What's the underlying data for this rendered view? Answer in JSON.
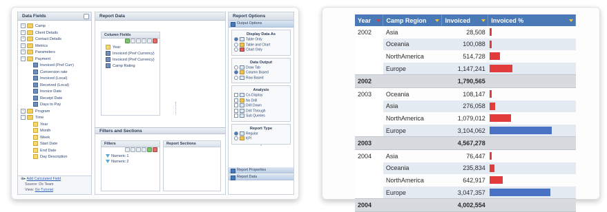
{
  "designer": {
    "data_fields_title": "Data Fields",
    "tree": [
      {
        "label": "Camp",
        "type": "folder",
        "level": 0,
        "expander": "+"
      },
      {
        "label": "Client Details",
        "type": "folder",
        "level": 0,
        "expander": "+"
      },
      {
        "label": "Contact Details",
        "type": "folder",
        "level": 0,
        "expander": "+"
      },
      {
        "label": "Metrics",
        "type": "folder",
        "level": 0,
        "expander": "+"
      },
      {
        "label": "Parameters",
        "type": "folder",
        "level": 0,
        "expander": "+"
      },
      {
        "label": "Payment",
        "type": "folder",
        "level": 0,
        "expander": "−"
      },
      {
        "label": "Invoiced (Pref Curr)",
        "type": "field",
        "level": 1
      },
      {
        "label": "Conversion rate",
        "type": "field",
        "level": 1
      },
      {
        "label": "Invoiced (Local)",
        "type": "field",
        "level": 1
      },
      {
        "label": "Received (Local)",
        "type": "field",
        "level": 1
      },
      {
        "label": "Invoice Date",
        "type": "field",
        "level": 1
      },
      {
        "label": "Receipt Date",
        "type": "field",
        "level": 1
      },
      {
        "label": "Days to Pay",
        "type": "field",
        "level": 1
      },
      {
        "label": "Program",
        "type": "folder",
        "level": 0,
        "expander": "+"
      },
      {
        "label": "Time",
        "type": "folder",
        "level": 0,
        "expander": "−"
      },
      {
        "label": "Year",
        "type": "date",
        "level": 1
      },
      {
        "label": "Month",
        "type": "date",
        "level": 1
      },
      {
        "label": "Week",
        "type": "date",
        "level": 1
      },
      {
        "label": "Start Date",
        "type": "date",
        "level": 1
      },
      {
        "label": "End Date",
        "type": "date",
        "level": 1
      },
      {
        "label": "Day Description",
        "type": "date",
        "level": 1
      }
    ],
    "add_calculated_field": "Add Calculated Field",
    "source_label": "Source: Ox Team",
    "view_prefix": "View: ",
    "view_link": "Go Tutorial",
    "report_data_title": "Report Data",
    "column_fields_title": "Column Fields",
    "column_fields": [
      "Year",
      "Invoiced (Pref Currency)",
      "Invoiced (Pref Currency)",
      "Camp Rating"
    ],
    "filters_sections_title": "Filters and Sections",
    "filters_title": "Filters",
    "filters": [
      "Numeric 1",
      "Numeric 2"
    ],
    "report_sections_title": "Report Sections",
    "report_options_title": "Report Options",
    "output_options_label": "Output Options",
    "display_data_as": {
      "title": "Display Data As",
      "options": [
        "Table Only",
        "Table and Chart",
        "Chart Only"
      ]
    },
    "data_output": {
      "title": "Data Output",
      "options": [
        "Draw Tab",
        "Column Based",
        "Row Based"
      ]
    },
    "analysis": {
      "title": "Analysis",
      "options": [
        "Co-Display",
        "No Drill",
        "Drill Down",
        "Drill Through",
        "Sub Queries"
      ]
    },
    "report_type": {
      "title": "Report Type",
      "options": [
        "Regular",
        "KPI"
      ]
    },
    "report_properties_label": "Report Properties",
    "report_data_label": "Report Data"
  },
  "report": {
    "headers": [
      "Year",
      "Camp Region",
      "Invoiced",
      "Invoiced %"
    ],
    "header_arrow_colors": [
      "#e23b3b",
      "#f2c531",
      "#f2c531",
      "#f2c531"
    ],
    "max_value": 3104062,
    "colors": {
      "header": "#4a79b8",
      "bar_red": "#e23b3b",
      "bar_blue": "#4a72c4",
      "band": "#e3eaf2",
      "total": "#d7dbe0"
    },
    "groups": [
      {
        "year": "2002",
        "rows": [
          {
            "region": "Asia",
            "invoiced": "28,508",
            "value": 28508,
            "bar": "red"
          },
          {
            "region": "Oceania",
            "invoiced": "100,088",
            "value": 100088,
            "bar": "red"
          },
          {
            "region": "NorthAmerica",
            "invoiced": "514,728",
            "value": 514728,
            "bar": "red"
          },
          {
            "region": "Europe",
            "invoiced": "1,147,241",
            "value": 1147241,
            "bar": "red"
          }
        ],
        "total": "1,790,565"
      },
      {
        "year": "2003",
        "rows": [
          {
            "region": "Oceania",
            "invoiced": "108,147",
            "value": 108147,
            "bar": "red"
          },
          {
            "region": "Asia",
            "invoiced": "276,058",
            "value": 276058,
            "bar": "red"
          },
          {
            "region": "NorthAmerica",
            "invoiced": "1,079,012",
            "value": 1079012,
            "bar": "red"
          },
          {
            "region": "Europe",
            "invoiced": "3,104,062",
            "value": 3104062,
            "bar": "blue"
          }
        ],
        "total": "4,567,278"
      },
      {
        "year": "2004",
        "rows": [
          {
            "region": "Asia",
            "invoiced": "76,447",
            "value": 76447,
            "bar": "red"
          },
          {
            "region": "Oceania",
            "invoiced": "235,834",
            "value": 235834,
            "bar": "red"
          },
          {
            "region": "NorthAmerica",
            "invoiced": "642,917",
            "value": 642917,
            "bar": "red"
          },
          {
            "region": "Europe",
            "invoiced": "3,047,357",
            "value": 3047357,
            "bar": "blue"
          }
        ],
        "total": "4,002,554"
      }
    ]
  }
}
